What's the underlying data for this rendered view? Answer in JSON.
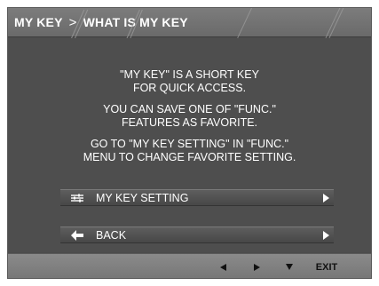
{
  "header": {
    "crumb_root": "MY KEY",
    "separator": ">",
    "crumb_current": "WHAT IS MY KEY"
  },
  "message": {
    "lines": [
      "\"MY KEY\" IS A SHORT KEY",
      "FOR QUICK ACCESS.",
      "YOU CAN SAVE ONE OF \"FUNC.\"",
      "FEATURES AS FAVORITE.",
      "GO TO \"MY KEY SETTING\" IN \"FUNC.\"",
      "MENU TO CHANGE FAVORITE SETTING."
    ]
  },
  "menu": {
    "items": [
      {
        "label": "MY KEY SETTING",
        "icon": "sliders-icon",
        "arrow": "arrow-right-icon"
      },
      {
        "label": "BACK",
        "icon": "back-arrow-icon",
        "arrow": "arrow-right-icon"
      }
    ]
  },
  "bottombar": {
    "exit_label": "EXIT",
    "keys": [
      "left-key-icon",
      "right-key-icon",
      "down-key-icon"
    ]
  },
  "colors": {
    "background": "#4b4b4b",
    "titlebar": "#6f6f6f",
    "bottombar": "#808080",
    "text": "#ffffff"
  }
}
